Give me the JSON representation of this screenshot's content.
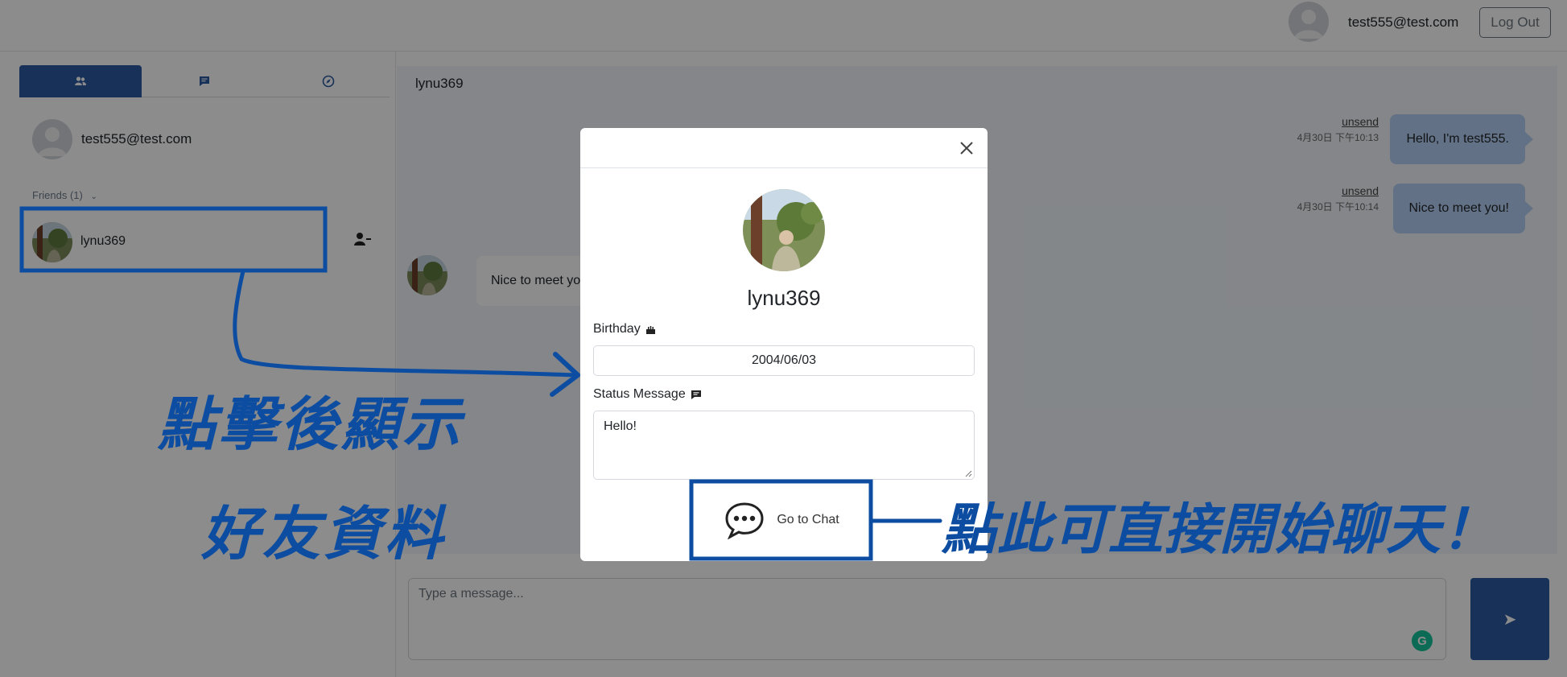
{
  "header": {
    "user_email": "test555@test.com",
    "logout_label": "Log Out"
  },
  "sidebar": {
    "tabs": [
      {
        "name": "friends",
        "icon": "users-icon",
        "active": true
      },
      {
        "name": "chats",
        "icon": "message-icon",
        "active": false
      },
      {
        "name": "explore",
        "icon": "compass-icon",
        "active": false
      }
    ],
    "me_email": "test555@test.com",
    "friends_label": "Friends (1)",
    "friends": [
      {
        "name": "lynu369"
      }
    ]
  },
  "chat": {
    "partner_name": "lynu369",
    "messages_out": [
      {
        "text": "Hello, I'm test555.",
        "unsend_label": "unsend",
        "time": "4月30日 下午10:13"
      },
      {
        "text": "Nice to meet you!",
        "unsend_label": "unsend",
        "time": "4月30日 下午10:14"
      }
    ],
    "messages_in": [
      {
        "text": "Nice to meet you!"
      }
    ],
    "composer_placeholder": "Type a message..."
  },
  "modal": {
    "name": "lynu369",
    "birthday_label": "Birthday",
    "birthday_value": "2004/06/03",
    "status_label": "Status Message",
    "status_value": "Hello!",
    "go_chat_label": "Go to Chat"
  },
  "annotations": {
    "left_line1": "點擊後顯示",
    "left_line2": "好友資料",
    "right_text": "點此可直接開始聊天！",
    "color": "#0d4da1"
  },
  "colors": {
    "primary": "#2b5aa2",
    "bubble_out": "#b2cef3",
    "chat_bg": "#f1f5fa"
  }
}
